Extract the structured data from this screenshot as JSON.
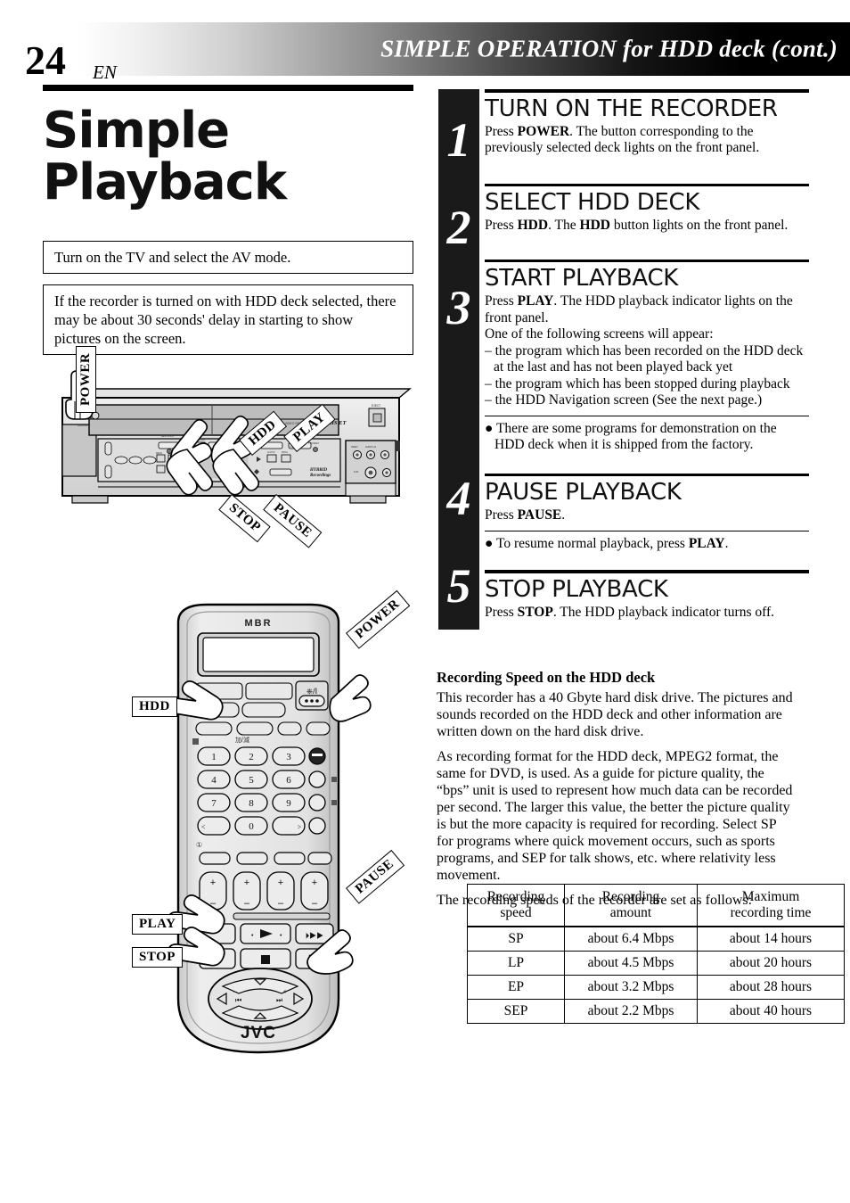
{
  "header": {
    "page_number": "24",
    "page_lang": "EN",
    "title": "SIMPLE OPERATION for HDD deck (cont.)"
  },
  "left": {
    "title_line1": "Simple",
    "title_line2": "Playback",
    "note1": "Turn on the TV and select the AV mode.",
    "note2": "If the recorder is turned on with HDD deck selected, there may be about 30 seconds' delay in starting to show pictures on the screen."
  },
  "device_diagram": {
    "callouts": [
      "POWER",
      "HDD",
      "PLAY",
      "STOP",
      "PAUSE"
    ],
    "panel_text": "Super VHS ET",
    "eject_label": "EJECT"
  },
  "remote_diagram": {
    "brand_top": "MBR",
    "brand_bottom": "JVC",
    "power_symbol": "⏻/I",
    "callouts": [
      "POWER",
      "HDD",
      "PLAY",
      "STOP",
      "PAUSE"
    ],
    "keys": [
      "1",
      "2",
      "3",
      "4",
      "5",
      "6",
      "7",
      "8",
      "9",
      "0"
    ]
  },
  "steps": [
    {
      "number": "1",
      "heading": "TURN ON THE RECORDER",
      "body": "Press POWER. The button corresponding to the previously selected deck lights on the front panel."
    },
    {
      "number": "2",
      "heading": "SELECT HDD DECK",
      "body": "Press HDD. The HDD button lights on the front panel."
    },
    {
      "number": "3",
      "heading": "START PLAYBACK",
      "body": "Press PLAY. The HDD playback indicator lights on the front panel.",
      "body2": "One of the following screens will appear:",
      "dashes": [
        "– the program which has been recorded on the HDD deck at the last and has not been played back yet",
        "– the program which has been stopped during playback",
        "– the HDD Navigation screen (See the next page.)"
      ],
      "bullet": "● There are some programs for demonstration on the HDD deck when it is shipped from the factory."
    },
    {
      "number": "4",
      "heading": "PAUSE PLAYBACK",
      "body": "Press PAUSE.",
      "bullet": "● To resume normal playback, press PLAY."
    },
    {
      "number": "5",
      "heading": "STOP PLAYBACK",
      "body": "Press STOP. The HDD playback indicator turns off."
    }
  ],
  "article": {
    "heading": "Recording Speed on the HDD deck",
    "p1": "This recorder has a 40 Gbyte hard disk drive. The pictures and sounds recorded on the HDD deck and other information are written down on the hard disk drive.",
    "p2": "As recording format for the HDD deck, MPEG2 format, the same for DVD, is used. As a guide for picture quality, the “bps” unit is used to represent how much data can be recorded per second. The larger this value, the better the picture quality is but the more capacity is required for recording. Select SP for programs where quick movement occurs, such as sports programs, and SEP for talk shows, etc. where relativity less movement.",
    "p3": "The recording speeds of the recorder are set as follows:"
  },
  "table": {
    "headers": [
      "Recording speed",
      "Recording amount",
      "Maximum recording time"
    ],
    "header_lines": [
      [
        "Recording",
        "speed"
      ],
      [
        "Recording",
        "amount"
      ],
      [
        "Maximum",
        "recording time"
      ]
    ],
    "rows": [
      [
        "SP",
        "about 6.4 Mbps",
        "about 14 hours"
      ],
      [
        "LP",
        "about 4.5 Mbps",
        "about 20 hours"
      ],
      [
        "EP",
        "about 3.2 Mbps",
        "about 28 hours"
      ],
      [
        "SEP",
        "about 2.2 Mbps",
        "about 40 hours"
      ]
    ]
  },
  "colors": {
    "ink": "#000000",
    "bar": "#1a1a1a",
    "device_body": "#d5d5d5"
  }
}
